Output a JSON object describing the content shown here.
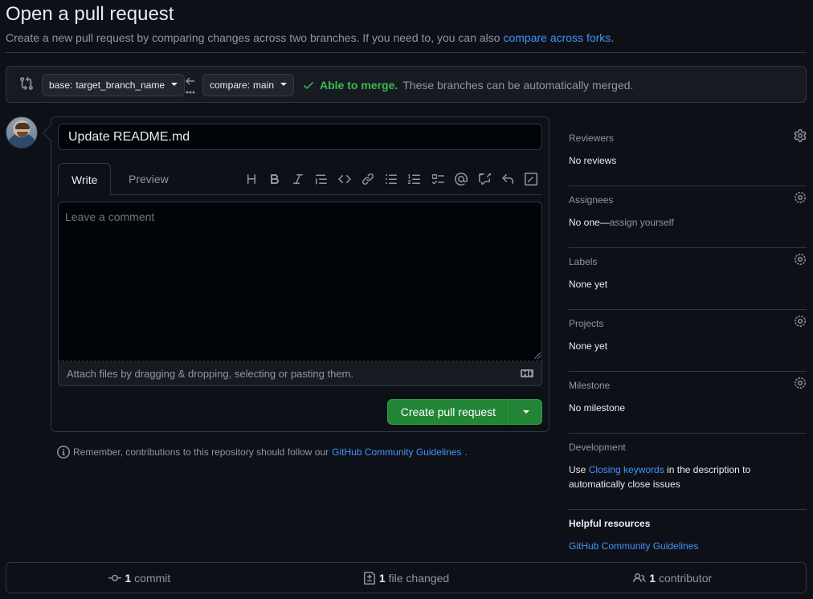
{
  "header": {
    "title": "Open a pull request",
    "subtitle_prefix": "Create a new pull request by comparing changes across two branches. If you need to, you can also",
    "subtitle_link": "compare across forks",
    "subtitle_suffix": "."
  },
  "compare": {
    "base_prefix": "base:",
    "base_branch": "target_branch_name",
    "compare_prefix": "compare:",
    "compare_branch": "main",
    "merge_ok": "Able to merge.",
    "merge_desc": "These branches can be automatically merged."
  },
  "form": {
    "title_value": "Update README.md",
    "tab_write": "Write",
    "tab_preview": "Preview",
    "comment_placeholder": "Leave a comment",
    "attach_text": "Attach files by dragging & dropping, selecting or pasting them.",
    "create_label": "Create pull request",
    "toolbar_icons": [
      "heading-icon",
      "bold-icon",
      "italic-icon",
      "quote-icon",
      "code-icon",
      "link-icon",
      "unordered-list-icon",
      "ordered-list-icon",
      "task-list-icon",
      "mention-icon",
      "cross-reference-icon",
      "saved-reply-icon",
      "slash-commands-icon"
    ]
  },
  "reminder": {
    "prefix": "Remember, contributions to this repository should follow our",
    "link": "GitHub Community Guidelines",
    "suffix": "."
  },
  "sidebar": {
    "reviewers": {
      "heading": "Reviewers",
      "value": "No reviews"
    },
    "assignees": {
      "heading": "Assignees",
      "value": "No one—",
      "link": "assign yourself"
    },
    "labels": {
      "heading": "Labels",
      "value": "None yet"
    },
    "projects": {
      "heading": "Projects",
      "value": "None yet"
    },
    "milestone": {
      "heading": "Milestone",
      "value": "No milestone"
    },
    "development": {
      "heading": "Development",
      "prefix": "Use",
      "link": "Closing keywords",
      "suffix": "in the description to automatically close issues"
    },
    "helpful": {
      "heading": "Helpful resources",
      "link": "GitHub Community Guidelines"
    }
  },
  "footer": {
    "commits_count": "1",
    "commits_label": "commit",
    "files_count": "1",
    "files_label": "file changed",
    "contributors_count": "1",
    "contributors_label": "contributor"
  },
  "colors": {
    "background": "#0d1117",
    "accent_link": "#4493f8",
    "success": "#3fb950",
    "button_green": "#238636"
  }
}
